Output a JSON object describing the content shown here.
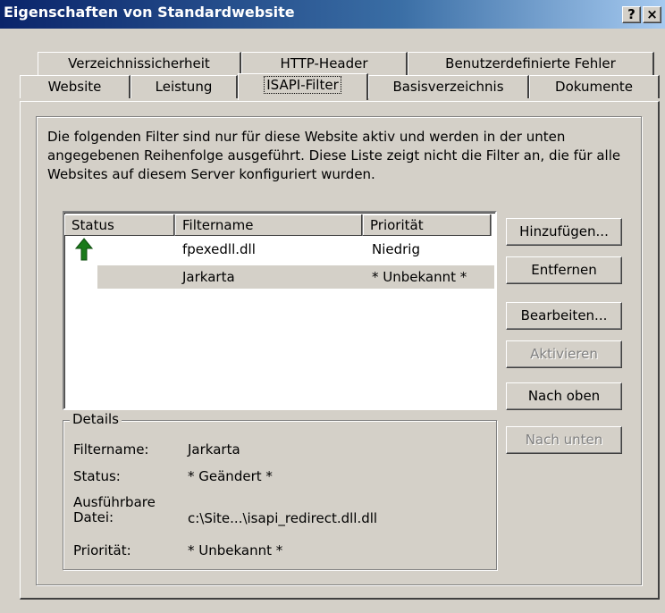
{
  "window": {
    "title": "Eigenschaften von Standardwebsite",
    "help_btn": "?",
    "close_btn": "×"
  },
  "tabs_back": [
    "Verzeichnissicherheit",
    "HTTP-Header",
    "Benutzerdefinierte Fehler"
  ],
  "tabs_front": [
    "Website",
    "Leistung",
    "ISAPI-Filter",
    "Basisverzeichnis",
    "Dokumente"
  ],
  "description": "Die folgenden Filter sind nur für diese Website aktiv und werden in der unten angegebenen Reihenfolge ausgeführt. Diese Liste zeigt nicht die Filter an, die für alle Websites auf diesem Server konfiguriert wurden.",
  "list": {
    "columns": [
      "Status",
      "Filtername",
      "Priorität"
    ],
    "rows": [
      {
        "status_icon": "green-up-arrow-icon",
        "name": "fpexedll.dll",
        "priority": "Niedrig"
      },
      {
        "status_icon": "",
        "name": "Jarkarta",
        "priority": "* Unbekannt *"
      }
    ]
  },
  "buttons": {
    "add": "Hinzufügen...",
    "remove": "Entfernen",
    "edit": "Bearbeiten...",
    "enable": "Aktivieren",
    "up": "Nach oben",
    "down": "Nach unten"
  },
  "details": {
    "legend": "Details",
    "filtername_label": "Filtername:",
    "filtername_value": "Jarkarta",
    "status_label": "Status:",
    "status_value": "* Geändert *",
    "exe_label_1": "Ausführbare",
    "exe_label_2": "Datei:",
    "exe_value": "c:\\Site...\\isapi_redirect.dll.dll",
    "priority_label": "Priorität:",
    "priority_value": "* Unbekannt *"
  },
  "colors": {
    "titlebar": "#0a246a",
    "face": "#d4d0c8",
    "arrow": "#1a7a1a"
  }
}
